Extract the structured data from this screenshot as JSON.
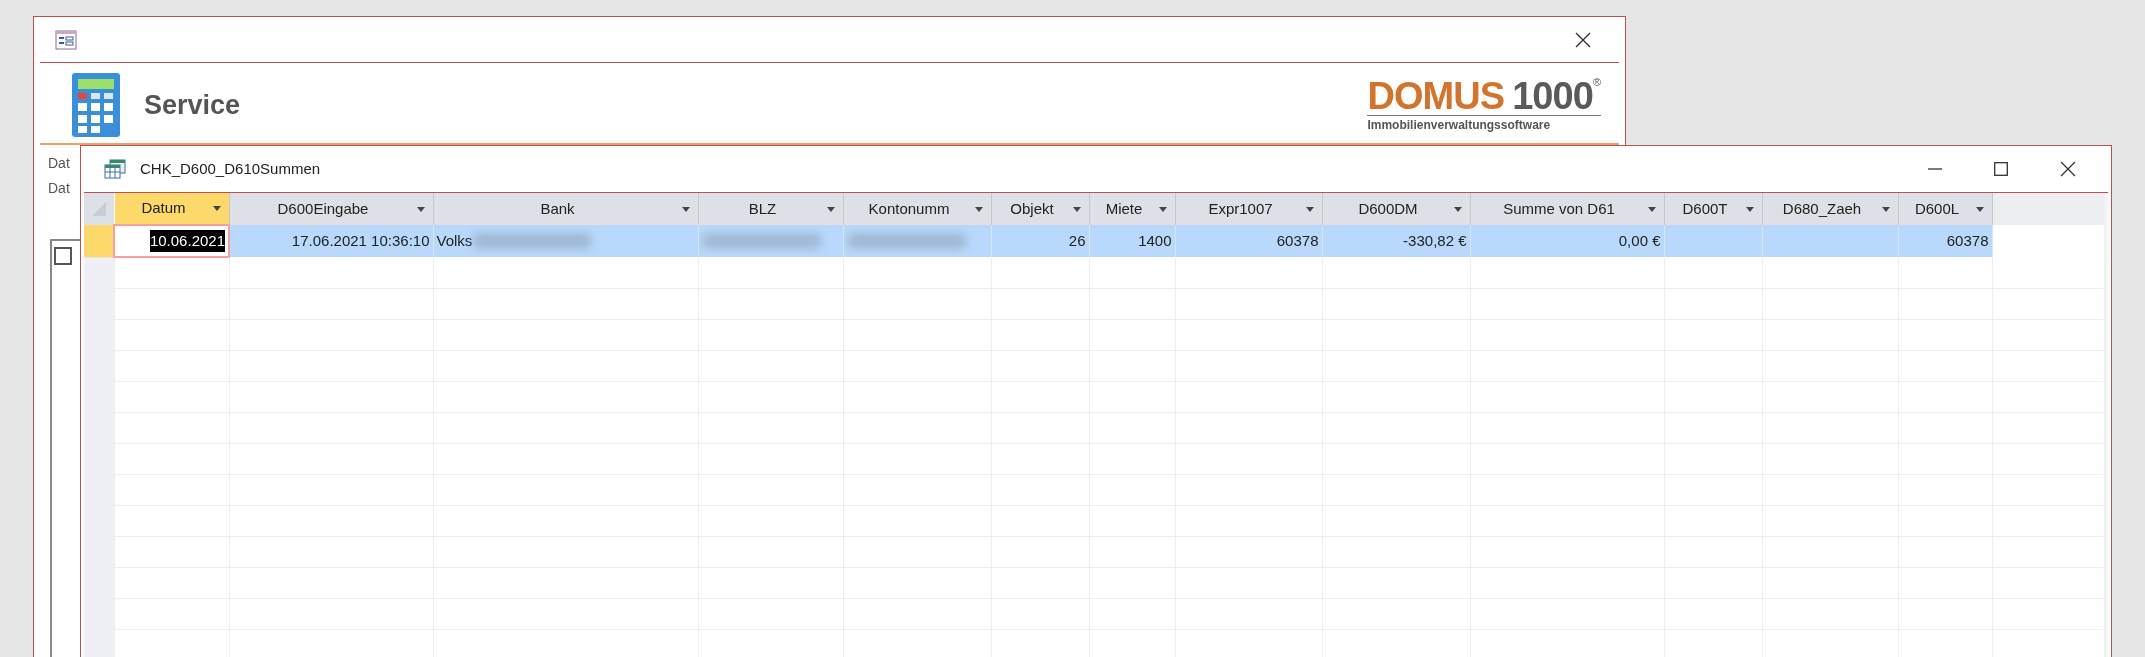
{
  "back_window": {
    "heading": "Service",
    "logo": {
      "brand": "DOMUS",
      "number": "1000",
      "mark": "®",
      "tagline": "Immobilienverwaltungssoftware"
    },
    "labels": [
      "Dat",
      "Dat"
    ],
    "checkbox": {
      "checked": false
    }
  },
  "front_window": {
    "title": "CHK_D600_D610Summen",
    "columns": [
      {
        "label": "Datum",
        "kind": "number",
        "selected": true
      },
      {
        "label": "D600Eingabe",
        "kind": "number",
        "selected": false
      },
      {
        "label": "Bank",
        "kind": "text",
        "selected": false
      },
      {
        "label": "BLZ",
        "kind": "text",
        "selected": false
      },
      {
        "label": "Kontonumm",
        "kind": "text",
        "selected": false
      },
      {
        "label": "Objekt",
        "kind": "number",
        "selected": false
      },
      {
        "label": "Miete",
        "kind": "number",
        "selected": false
      },
      {
        "label": "Expr1007",
        "kind": "number",
        "selected": false
      },
      {
        "label": "D600DM",
        "kind": "number",
        "selected": false
      },
      {
        "label": "Summe von D61",
        "kind": "number",
        "selected": false
      },
      {
        "label": "D600T",
        "kind": "number",
        "selected": false
      },
      {
        "label": "D680_Zaeh",
        "kind": "number",
        "selected": false
      },
      {
        "label": "D600L",
        "kind": "number",
        "selected": false
      }
    ],
    "rows": [
      {
        "selected": true,
        "cells": [
          {
            "text": "10.06.2021",
            "focused": true
          },
          {
            "text": "17.06.2021 10:36:10"
          },
          {
            "text": "Volks",
            "blurred": true
          },
          {
            "blurred": true
          },
          {
            "blurred": true
          },
          {
            "text": "26"
          },
          {
            "text": "1400"
          },
          {
            "text": "60378"
          },
          {
            "text": "-330,82 €"
          },
          {
            "text": "0,00 €"
          },
          {},
          {},
          {
            "text": "60378"
          }
        ]
      }
    ]
  }
}
